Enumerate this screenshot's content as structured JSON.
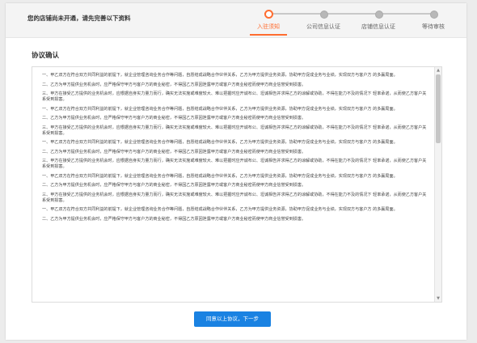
{
  "header": {
    "notice": "您的店铺尚未开通，请先完善以下资料"
  },
  "steps": [
    {
      "label": "入驻须知",
      "active": true
    },
    {
      "label": "公司信息认证",
      "active": false
    },
    {
      "label": "店铺信息认证",
      "active": false
    },
    {
      "label": "等待审核",
      "active": false
    }
  ],
  "colors": {
    "accent": "#ff6d30",
    "button": "#1a82e2"
  },
  "section_title": "协议确认",
  "agreement": {
    "paragraphs": [
      "一、甲乙双方在符合双方共同利益的前提下，就企业管理咨询业务合作等问题，自愿结成战略合作伙伴关系，乙方为甲方提供业务资源，协助甲方促成业务与业绩，实现双方与客户方 的多赢局面。",
      "二、乙方为甲方提供业务机会时，应严格保守甲方与客户方的商业秘密，不得因乙方原因泄露甲方或客户方商业秘密而使甲方商业信誉受到损害。",
      "三、甲方在接受乙方提供的业务机会时，应根据自身实力量力而行，确实无法实施或难度较大、难以把握时应开诚布公、坦诚相告并求得乙方的谅解或协助，不得在能力不及的情况下 轻率承诺，从而使乙方客户关系受到损害。",
      "一、甲乙双方在符合双方共同利益的前提下，就企业管理咨询业务合作等问题，自愿结成战略合作伙伴关系，乙方为甲方提供业务资源，协助甲方促成业务与业绩，实现双方与客户方 的多赢局面。",
      "二、乙方为甲方提供业务机会时，应严格保守甲方与客户方的商业秘密，不得因乙方原因泄露甲方或客户方商业秘密而使甲方商业信誉受到损害。",
      "三、甲方在接受乙方提供的业务机会时，应根据自身实力量力而行，确实无法实施或难度较大、难以把握时应开诚布公、坦诚相告并求得乙方的谅解或协助，不得在能力不及的情况下 轻率承诺，从而使乙方客户关系受到损害。",
      "一、甲乙双方在符合双方共同利益的前提下，就企业管理咨询业务合作等问题，自愿结成战略合作伙伴关系，乙方为甲方提供业务资源，协助甲方促成业务与业绩，实现双方与客户方 的多赢局面。",
      "二、乙方为甲方提供业务机会时，应严格保守甲方与客户方的商业秘密，不得因乙方原因泄露甲方或客户方商业秘密而使甲方商业信誉受到损害。",
      "三、甲方在接受乙方提供的业务机会时，应根据自身实力量力而行，确实无法实施或难度较大、难以把握时应开诚布公、坦诚相告并求得乙方的谅解或协助，不得在能力不及的情况下 轻率承诺，从而使乙方客户关系受到损害。",
      "一、甲乙双方在符合双方共同利益的前提下，就企业管理咨询业务合作等问题，自愿结成战略合作伙伴关系，乙方为甲方提供业务资源，协助甲方促成业务与业绩，实现双方与客户方 的多赢局面。",
      "二、乙方为甲方提供业务机会时，应严格保守甲方与客户方的商业秘密，不得因乙方原因泄露甲方或客户方商业秘密而使甲方商业信誉受到损害。",
      "三、甲方在接受乙方提供的业务机会时，应根据自身实力量力而行，确实无法实施或难度较大、难以把握时应开诚布公、坦诚相告并求得乙方的谅解或协助，不得在能力不及的情况下 轻率承诺，从而使乙方客户关系受到损害。",
      "一、甲乙双方在符合双方共同利益的前提下，就企业管理咨询业务合作等问题，自愿结成战略合作伙伴关系，乙方为甲方提供业务资源，协助甲方促成业务与业绩，实现双方与客户方 的多赢局面。",
      "二、乙方为甲方提供业务机会时，应严格保守甲方与客户方的商业秘密，不得因乙方原因泄露甲方或客户方商业秘密而使甲方商业信誉受到损害。"
    ],
    "scroll_position": 0
  },
  "next_button": "同意以上协议，下一步"
}
